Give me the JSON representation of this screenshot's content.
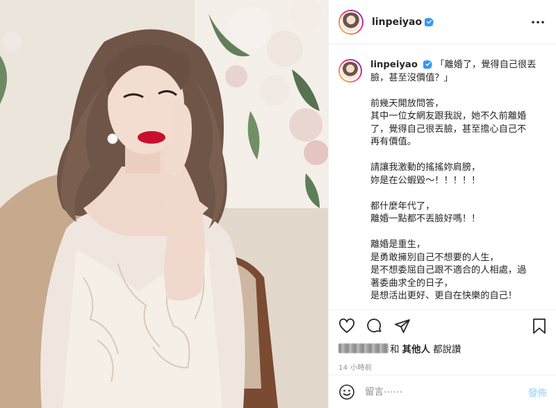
{
  "post": {
    "username": "linpeiyao",
    "caption_lines": [
      "「離婚了，覺得自己很丟",
      "臉，甚至沒價值？」"
    ],
    "caption_blocks": [
      [
        "前幾天開放問答，",
        "其中一位女網友跟我說，她不久前離婚",
        "了，覺得自己很丟臉，甚至擔心自己不",
        "再有價值。"
      ],
      [
        "請讓我激動的搖搖妳肩膀，",
        "妳是在公蝦毀～！！！！！"
      ],
      [
        "都什麼年代了，",
        "離婚一點都不丟臉好嗎！！"
      ],
      [
        "離婚是重生，",
        "是勇敢擁別自己不想要的人生，",
        "是不想委屈自己跟不適合的人相處，過",
        "著委曲求全的日子，",
        "是想活出更好、更自在快樂的自己！"
      ]
    ],
    "likes_text": "和",
    "likes_others": "其他人",
    "likes_suffix": "都說讚",
    "timestamp": "14 小時前",
    "comment_placeholder": "留言⋯⋯",
    "post_button": "發佈"
  },
  "icons": {
    "verified": "verified-badge-icon",
    "more": "more-options-icon",
    "like": "heart-icon",
    "comment": "comment-icon",
    "share": "paper-plane-icon",
    "save": "bookmark-icon",
    "emoji": "smiley-icon"
  },
  "colors": {
    "verified_blue": "#3897f0",
    "post_button_disabled": "#b2dffc",
    "lipstick": "#c8102e"
  }
}
